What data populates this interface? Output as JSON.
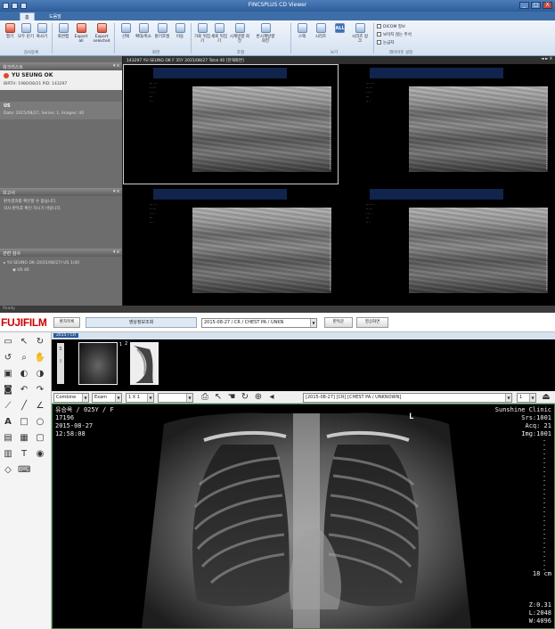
{
  "app": {
    "title": "FINCSPLUS CD Viewer",
    "window_controls": [
      "_",
      "□",
      "X"
    ],
    "tabs": [
      "홈",
      "도움말"
    ]
  },
  "ribbon": {
    "buttons": [
      "열기",
      "모두 닫기",
      "복사기",
      "화면캡",
      "Export all",
      "Export selected",
      "선택",
      "확대/축소",
      "밝기조절",
      "이동",
      "가로 뒤집기",
      "세로 뒤집기",
      "시계방향 회전",
      "반시계방향 회전",
      "스택",
      "시리즈",
      "ALL",
      "시리즈 링크"
    ],
    "groups": [
      "검사등록",
      "화면",
      "조절",
      "보기",
      "레이아웃 설정"
    ],
    "options": [
      "DICOM 정보",
      "보이지 않는 주석",
      "눈금자"
    ]
  },
  "left_panel": {
    "worklist_header": "워크리스트",
    "patient_name": "YU SEUNG OK",
    "patient_info": "BIRTH: 1980/08/21  PID: 143297",
    "study_label": "US",
    "study_info": "Date: 2015/08/27,  Series: 1,  Images: 40",
    "report_header": "보고서",
    "report_text": [
      "판독결과를 확인할 수 없습니다.",
      "의사 판독후 확인 하시기 바랍니다."
    ],
    "related_header": "관련 검사",
    "related_item": "YU SEUNG OK (2015/08/27) US  1/40",
    "related_sub": "US  40"
  },
  "viewport": {
    "header": "143297  YU SEUNG OK  F  35Y    2015/08/27    Total 40  [현재화면]",
    "panel_ctrls": [
      "◄",
      "►",
      "X"
    ]
  },
  "status": {
    "text": "Ready"
  },
  "fuji": {
    "logo_fuji": "FUJI",
    "logo_film": "FILM",
    "btn_patient": "환자목록",
    "study_label": "영상정보조회",
    "study_select": "2015-08-27 / CR / CHEST PA / UNKN",
    "btn_compare": "판독문",
    "btn_print": "영상화면",
    "strip_tab": "2015 / CR",
    "thumb_count_1": "1",
    "thumb_count_2": "2",
    "combo_mode": "Combine",
    "combo_exam": "Exam",
    "combo_layout": "1 X 1",
    "series_select": "[2015-08-27] [CR] [CHEST PA / UNKNOWN]",
    "page_select": "1",
    "overlay": {
      "tl": [
        "유승옥 / 025Y / F",
        "17196",
        "2015-08-27",
        "12:58:08"
      ],
      "marker": "L",
      "tr": [
        "Sunshine Clinic",
        "Srs:1001",
        "Acq: 21",
        "Img:1001"
      ],
      "scale": "18 cm",
      "br": [
        "Z:0.31",
        "L:2048",
        "W:4096"
      ]
    }
  }
}
